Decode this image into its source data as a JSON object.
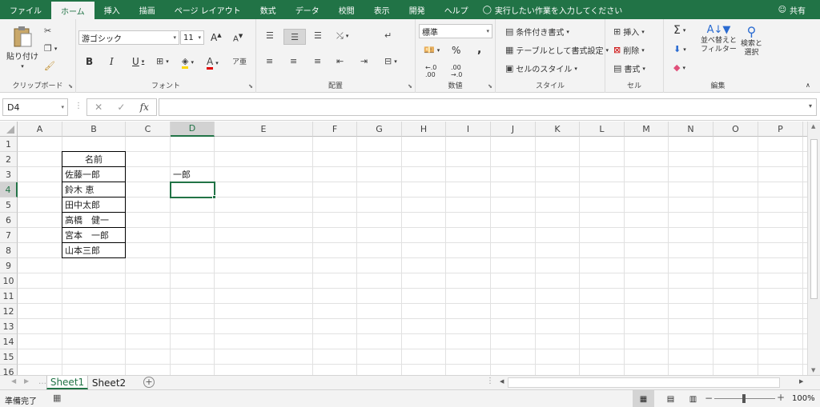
{
  "ribbon_tabs": [
    "ファイル",
    "ホーム",
    "挿入",
    "描画",
    "ページ レイアウト",
    "数式",
    "データ",
    "校閲",
    "表示",
    "開発",
    "ヘルプ"
  ],
  "tell_me": "実行したい作業を入力してください",
  "share": "共有",
  "clipboard": {
    "paste": "貼り付け",
    "label": "クリップボード"
  },
  "font": {
    "name": "游ゴシック",
    "size": "11",
    "bold": "B",
    "italic": "I",
    "underline": "U",
    "label": "フォント"
  },
  "alignment": {
    "label": "配置"
  },
  "number": {
    "format": "標準",
    "percent": "%",
    "comma": ",",
    "label": "数値"
  },
  "styles": {
    "conditional": "条件付き書式",
    "table": "テーブルとして書式設定",
    "cell_styles": "セルのスタイル",
    "label": "スタイル"
  },
  "cells": {
    "insert": "挿入",
    "delete": "削除",
    "format": "書式",
    "label": "セル"
  },
  "editing": {
    "sum": "Σ",
    "sort": "並べ替えと\nフィルター",
    "find": "検索と\n選択",
    "label": "編集"
  },
  "namebox": "D4",
  "fx": "fx",
  "columns": [
    "A",
    "B",
    "C",
    "D",
    "E",
    "F",
    "G",
    "H",
    "I",
    "J",
    "K",
    "L",
    "M",
    "N",
    "O",
    "P"
  ],
  "rows": [
    "1",
    "2",
    "3",
    "4",
    "5",
    "6",
    "7",
    "8",
    "9",
    "10",
    "11",
    "12",
    "13",
    "14",
    "15",
    "16"
  ],
  "cells_data": {
    "b2": "名前",
    "b3": "佐藤一郎",
    "b4": "鈴木 恵",
    "b5": "田中太郎",
    "b6": "高橋　健一",
    "b7": "宮本　一郎",
    "b8": "山本三郎",
    "d3": "一郎"
  },
  "sheets": [
    "Sheet1",
    "Sheet2"
  ],
  "status": {
    "ready": "準備完了",
    "zoom": "100%"
  },
  "colors": {
    "accent": "#217346"
  }
}
